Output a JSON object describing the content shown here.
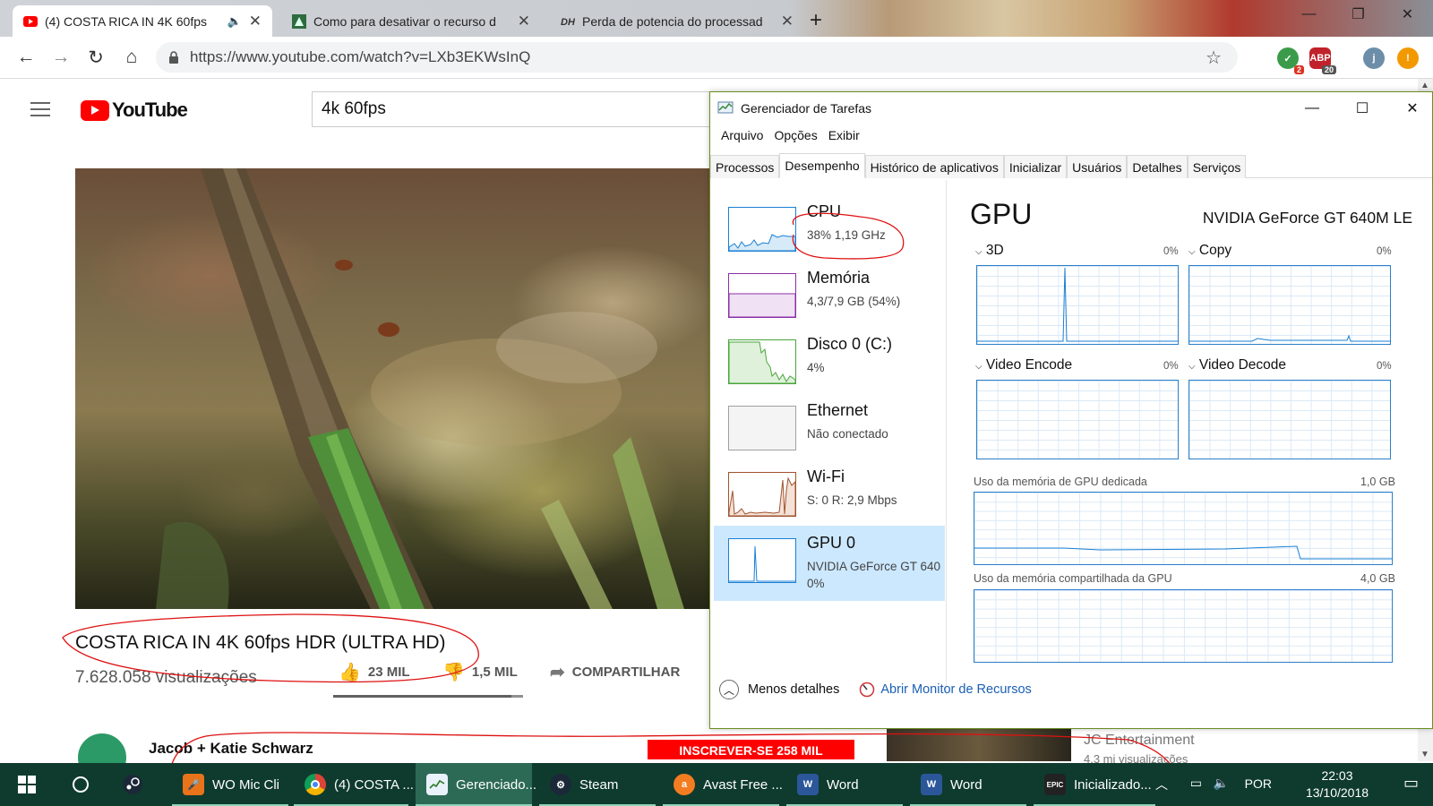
{
  "chrome": {
    "tabs": [
      {
        "title": "(4) COSTA RICA IN 4K 60fps",
        "active": true
      },
      {
        "title": "Como para desativar o recurso d",
        "active": false
      },
      {
        "title": "Perda de potencia do processad",
        "active": false
      }
    ],
    "url": "https://www.youtube.com/watch?v=LXb3EKWsInQ",
    "extensions": [
      {
        "badge": "2"
      },
      {
        "badge": "20"
      }
    ],
    "profile_initial": "j",
    "alert": "!"
  },
  "youtube": {
    "logo_text": "YouTube",
    "search_value": "4k 60fps",
    "video_title": "COSTA RICA IN 4K 60fps HDR (ULTRA HD)",
    "views": "7.628.058 visualizações",
    "likes": "23 MIL",
    "dislikes": "1,5 MIL",
    "share": "COMPARTILHAR",
    "likes_ratio": 0.94,
    "channel": "Jacob + Katie Schwarz",
    "subscribe": "INSCREVER-SE  258 MIL",
    "reco_channel": "JC Entertainment",
    "reco_views": "4,3 mi visualizações"
  },
  "task_manager": {
    "title": "Gerenciador de Tarefas",
    "menu": [
      "Arquivo",
      "Opções",
      "Exibir"
    ],
    "tabs": [
      "Processos",
      "Desempenho",
      "Histórico de aplicativos",
      "Inicializar",
      "Usuários",
      "Detalhes",
      "Serviços"
    ],
    "selected_tab": "Desempenho",
    "resources": [
      {
        "name": "CPU",
        "detail": "38%  1,19 GHz",
        "color": "#1a7fd4"
      },
      {
        "name": "Memória",
        "detail": "4,3/7,9 GB (54%)",
        "color": "#8b2fa6"
      },
      {
        "name": "Disco 0 (C:)",
        "detail": "4%",
        "color": "#4aa53c"
      },
      {
        "name": "Ethernet",
        "detail": "Não conectado",
        "color": "#a0a0a0"
      },
      {
        "name": "Wi-Fi",
        "detail_s": "S: 0",
        "detail_r": "R: 2,9 Mbps",
        "color": "#a0522d"
      },
      {
        "name": "GPU 0",
        "detail": "NVIDIA GeForce GT 640",
        "detail2": "0%",
        "color": "#1a7fd4",
        "selected": true
      }
    ],
    "gpu": {
      "heading": "GPU",
      "model": "NVIDIA GeForce GT 640M LE",
      "engines": [
        {
          "name": "3D",
          "pct": "0%"
        },
        {
          "name": "Copy",
          "pct": "0%"
        },
        {
          "name": "Video Encode",
          "pct": "0%"
        },
        {
          "name": "Video Decode",
          "pct": "0%"
        }
      ],
      "dedicated_label": "Uso da memória de GPU dedicada",
      "dedicated_max": "1,0 GB",
      "shared_label": "Uso da memória compartilhada da GPU",
      "shared_max": "4,0 GB"
    },
    "footer": {
      "less": "Menos detalhes",
      "monitor": "Abrir Monitor de Recursos"
    }
  },
  "taskbar": {
    "items": [
      {
        "label": "WO Mic Cli",
        "color": "#e8731a"
      },
      {
        "label": "(4) COSTA ...",
        "color": "#db4437"
      },
      {
        "label": "Gerenciado...",
        "color": "#4f9bd6",
        "active": true
      },
      {
        "label": "Steam",
        "color": "#1b2838"
      },
      {
        "label": "Avast Free ...",
        "color": "#f47c20"
      },
      {
        "label": "Word",
        "color": "#2b579a"
      },
      {
        "label": "Word",
        "color": "#2b579a"
      },
      {
        "label": "Inicializado...",
        "color": "#222222"
      }
    ],
    "language": "POR",
    "time": "22:03",
    "date": "13/10/2018"
  }
}
